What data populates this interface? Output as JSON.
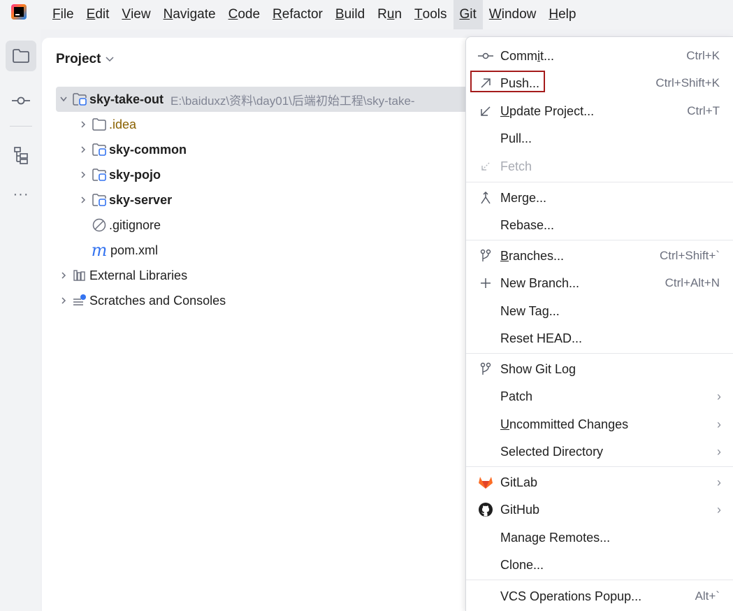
{
  "menubar": {
    "items": [
      {
        "mn": "F",
        "rest": "ile"
      },
      {
        "mn": "E",
        "rest": "dit"
      },
      {
        "mn": "V",
        "rest": "iew"
      },
      {
        "mn": "N",
        "rest": "avigate"
      },
      {
        "mn": "C",
        "rest": "ode"
      },
      {
        "mn": "R",
        "rest": "efactor"
      },
      {
        "mn": "B",
        "rest": "uild"
      },
      {
        "pre": "R",
        "mn": "u",
        "rest": "n"
      },
      {
        "mn": "T",
        "rest": "ools"
      },
      {
        "mn": "G",
        "rest": "it"
      },
      {
        "mn": "W",
        "rest": "indow"
      },
      {
        "mn": "H",
        "rest": "elp"
      }
    ],
    "active_index": 9
  },
  "toolstrip": {
    "icons": [
      "folder-icon",
      "commit-icon",
      "structure-icon",
      "more-icon"
    ],
    "more_glyph": "···"
  },
  "project": {
    "title": "Project",
    "tree": {
      "root": {
        "name": "sky-take-out",
        "path": "E:\\baiduxz\\资料\\day01\\后端初始工程\\sky-take-"
      },
      "idea": ".idea",
      "sky_common": "sky-common",
      "sky_pojo": "sky-pojo",
      "sky_server": "sky-server",
      "gitignore": ".gitignore",
      "pom": "pom.xml",
      "pom_glyph": "m",
      "ext_libs": "External Libraries",
      "scratches": "Scratches and Consoles"
    }
  },
  "git_menu": {
    "commit": {
      "pre": "Comm",
      "mn": "i",
      "rest": "t...",
      "shortcut": "Ctrl+K"
    },
    "push": {
      "label": "Push...",
      "shortcut": "Ctrl+Shift+K"
    },
    "update": {
      "mn": "U",
      "rest": "pdate Project...",
      "shortcut": "Ctrl+T"
    },
    "pull": {
      "label": "Pull..."
    },
    "fetch": {
      "label": "Fetch"
    },
    "merge": {
      "label": "Merge..."
    },
    "rebase": {
      "label": "Rebase..."
    },
    "branches": {
      "mn": "B",
      "rest": "ranches...",
      "shortcut": "Ctrl+Shift+`"
    },
    "new_branch": {
      "label": "New Branch...",
      "shortcut": "Ctrl+Alt+N"
    },
    "new_tag": {
      "label": "New Tag..."
    },
    "reset_head": {
      "label": "Reset HEAD..."
    },
    "show_log": {
      "label": "Show Git Log"
    },
    "patch": {
      "label": "Patch"
    },
    "uncommitted": {
      "mn": "U",
      "rest": "ncommitted Changes"
    },
    "selected_dir": {
      "label": "Selected Directory"
    },
    "gitlab": {
      "label": "GitLab"
    },
    "github": {
      "label": "GitHub"
    },
    "manage_remotes": {
      "label": "Manage Remotes..."
    },
    "clone": {
      "label": "Clone..."
    },
    "vcs_popup": {
      "label": "VCS Operations Popup...",
      "shortcut": "Alt+`"
    },
    "submenu_glyph": "›"
  },
  "colors": {
    "highlight_box": "#a51c1c",
    "gitlab": "#fc6d26",
    "folder_accent": "#3574f0"
  }
}
